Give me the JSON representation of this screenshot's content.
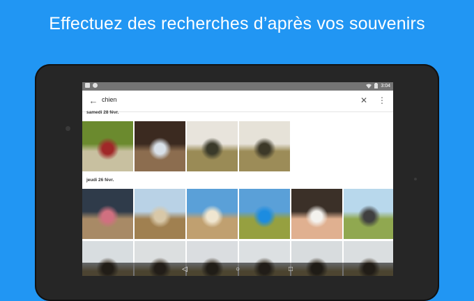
{
  "headline": "Effectuez des recherches d’après vos souvenirs",
  "status_bar": {
    "time": "3:04",
    "icons_left": [
      "image-icon",
      "notification-icon"
    ],
    "icons_right": [
      "wifi-icon",
      "battery-icon"
    ]
  },
  "search": {
    "query": "chien",
    "back_icon": "back-arrow-icon",
    "clear_icon": "close-icon",
    "menu_icon": "more-vert-icon"
  },
  "sections": [
    {
      "label": "samedi 28 févr.",
      "photos": [
        {
          "subject": "dog with red scarf",
          "colors": [
            "#6b8a2e",
            "#c8c0a0",
            "#a02828"
          ]
        },
        {
          "subject": "person hugging dog",
          "colors": [
            "#3b2a20",
            "#8c6d4f",
            "#d8e0e8"
          ]
        },
        {
          "subject": "group on hill",
          "colors": [
            "#e8e4dc",
            "#9a8b56",
            "#3a3a2a"
          ]
        },
        {
          "subject": "group on hill",
          "colors": [
            "#e6e2d8",
            "#9c8c58",
            "#3c3828"
          ]
        }
      ]
    },
    {
      "label": "jeudi 26 févr.",
      "photos": [
        {
          "subject": "person with dog",
          "colors": [
            "#2f3b4a",
            "#a88a66",
            "#d07080"
          ]
        },
        {
          "subject": "dog running",
          "colors": [
            "#b9d2e6",
            "#a08050",
            "#d8c8a8"
          ]
        },
        {
          "subject": "person playing with dog",
          "colors": [
            "#5aa0d8",
            "#c0a070",
            "#f0e6d0"
          ]
        },
        {
          "subject": "dog with frisbee",
          "colors": [
            "#5aa0d8",
            "#96a040",
            "#1c8ce0"
          ]
        },
        {
          "subject": "woman with dog",
          "colors": [
            "#3b3028",
            "#e0b090",
            "#f4f2ee"
          ]
        },
        {
          "subject": "hikers",
          "colors": [
            "#b8d8ec",
            "#90a850",
            "#404040"
          ]
        },
        {
          "subject": "group with dog",
          "colors": [
            "#d8dde0",
            "#a89870",
            "#4a4034"
          ]
        },
        {
          "subject": "group with dog",
          "colors": [
            "#dcdfe0",
            "#a49468",
            "#4c4236"
          ]
        },
        {
          "subject": "group with dog",
          "colors": [
            "#dadde0",
            "#a89a6c",
            "#484034"
          ]
        },
        {
          "subject": "group with dog",
          "colors": [
            "#dce0e2",
            "#a69668",
            "#4a4236"
          ]
        },
        {
          "subject": "group with dog",
          "colors": [
            "#d8dcde",
            "#aa9a6e",
            "#463e32"
          ]
        },
        {
          "subject": "group with dog",
          "colors": [
            "#dadee0",
            "#a6986a",
            "#4a4034"
          ]
        }
      ]
    }
  ],
  "nav": {
    "back": "◁",
    "home": "○",
    "recents": "□"
  },
  "colors": {
    "background": "#2196f3",
    "bezel": "#262626",
    "statusbar": "#757575"
  }
}
